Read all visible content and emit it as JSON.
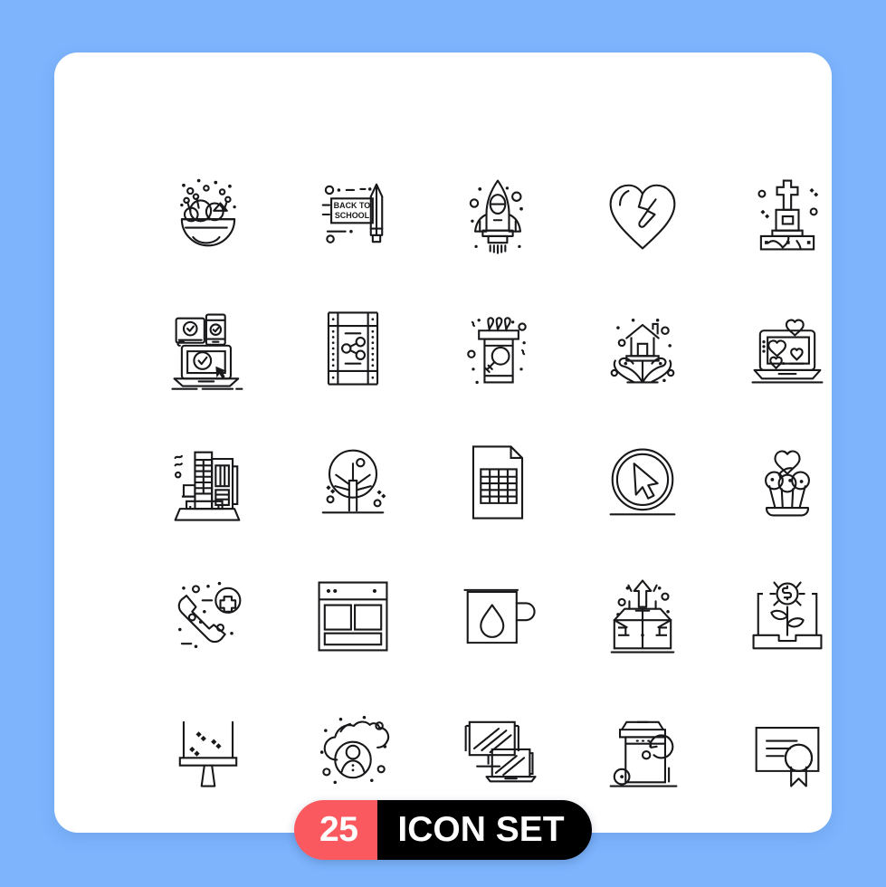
{
  "page": {
    "background_color": "#7db4fc",
    "card_color": "#ffffff"
  },
  "badge": {
    "count": "25",
    "label": "ICON SET",
    "count_bg": "#fa5a5f",
    "label_bg": "#000000",
    "text_color": "#ffffff"
  },
  "grid": {
    "columns": 5,
    "rows": 5,
    "style": "line / outline icons",
    "stroke_color": "#18181b"
  },
  "icons": [
    {
      "index": 1,
      "name": "fruit-bowl-icon",
      "label": "Fruit Bowl"
    },
    {
      "index": 2,
      "name": "back-to-school-icon",
      "label": "Back To School",
      "text": "BACK TO SCHOOL"
    },
    {
      "index": 3,
      "name": "rocket-launch-icon",
      "label": "Rocket"
    },
    {
      "index": 4,
      "name": "broken-heart-icon",
      "label": "Broken Heart"
    },
    {
      "index": 5,
      "name": "grave-tombstone-icon",
      "label": "Grave"
    },
    {
      "index": 6,
      "name": "responsive-devices-check-icon",
      "label": "Responsive Devices"
    },
    {
      "index": 7,
      "name": "film-strip-share-icon",
      "label": "Share Video"
    },
    {
      "index": 8,
      "name": "trash-bin-search-icon",
      "label": "Waste Search"
    },
    {
      "index": 9,
      "name": "house-in-hands-icon",
      "label": "Home Insurance"
    },
    {
      "index": 10,
      "name": "laptop-hearts-icon",
      "label": "Online Dating"
    },
    {
      "index": 11,
      "name": "city-buildings-icon",
      "label": "City Buildings"
    },
    {
      "index": 12,
      "name": "tree-icon",
      "label": "Tree"
    },
    {
      "index": 13,
      "name": "spreadsheet-file-icon",
      "label": "Spreadsheet File"
    },
    {
      "index": 14,
      "name": "cursor-circle-icon",
      "label": "Click Pointer"
    },
    {
      "index": 15,
      "name": "cupcake-heart-icon",
      "label": "Cupcake"
    },
    {
      "index": 16,
      "name": "emergency-call-icon",
      "label": "Emergency Call"
    },
    {
      "index": 17,
      "name": "browser-layout-icon",
      "label": "Web Layout"
    },
    {
      "index": 18,
      "name": "mug-water-drop-icon",
      "label": "Mug"
    },
    {
      "index": 19,
      "name": "open-box-arrow-icon",
      "label": "Unboxing"
    },
    {
      "index": 20,
      "name": "money-plant-growth-icon",
      "label": "Investment Growth"
    },
    {
      "index": 21,
      "name": "squeegee-cleaning-icon",
      "label": "Window Cleaner"
    },
    {
      "index": 22,
      "name": "cloud-user-icon",
      "label": "Cloud User"
    },
    {
      "index": 23,
      "name": "monitor-laptop-icon",
      "label": "Devices"
    },
    {
      "index": 24,
      "name": "recycle-bin-icon",
      "label": "Recycling Bin"
    },
    {
      "index": 25,
      "name": "certificate-icon",
      "label": "Certificate"
    }
  ]
}
